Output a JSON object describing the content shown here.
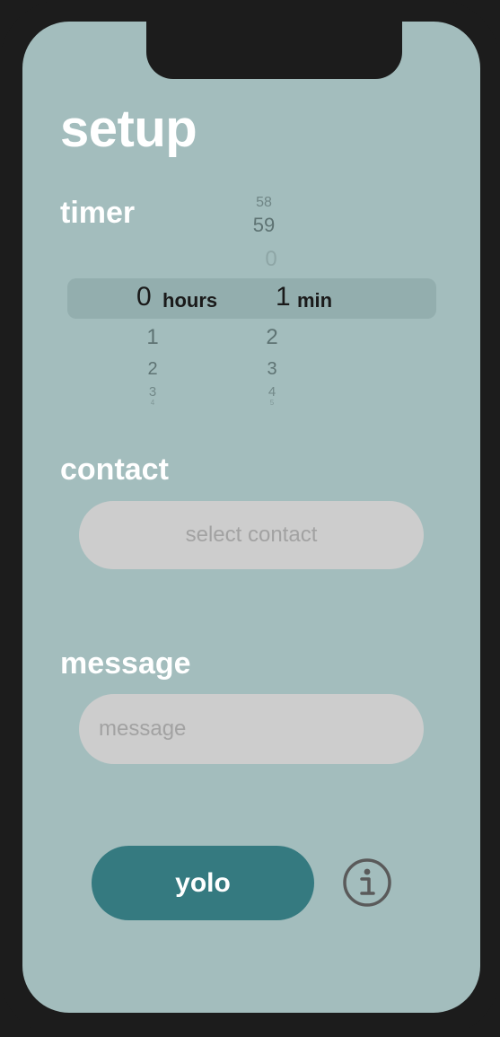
{
  "screen": {
    "title": "setup"
  },
  "timer": {
    "label": "timer",
    "hours_label": "hours",
    "min_label": "min",
    "hours_selected": "0",
    "hours_below": [
      "1",
      "2",
      "3",
      "4"
    ],
    "min_above": [
      "58",
      "59",
      "0"
    ],
    "min_selected": "1",
    "min_below": [
      "2",
      "3",
      "4",
      "5"
    ]
  },
  "contact": {
    "label": "contact",
    "button_label": "select contact"
  },
  "message": {
    "label": "message",
    "placeholder": "message"
  },
  "actions": {
    "go_label": "yolo",
    "info_icon": "info-circle-icon"
  },
  "colors": {
    "background": "#a3bdbd",
    "accent": "#357a80",
    "field": "#cdcdcd"
  }
}
